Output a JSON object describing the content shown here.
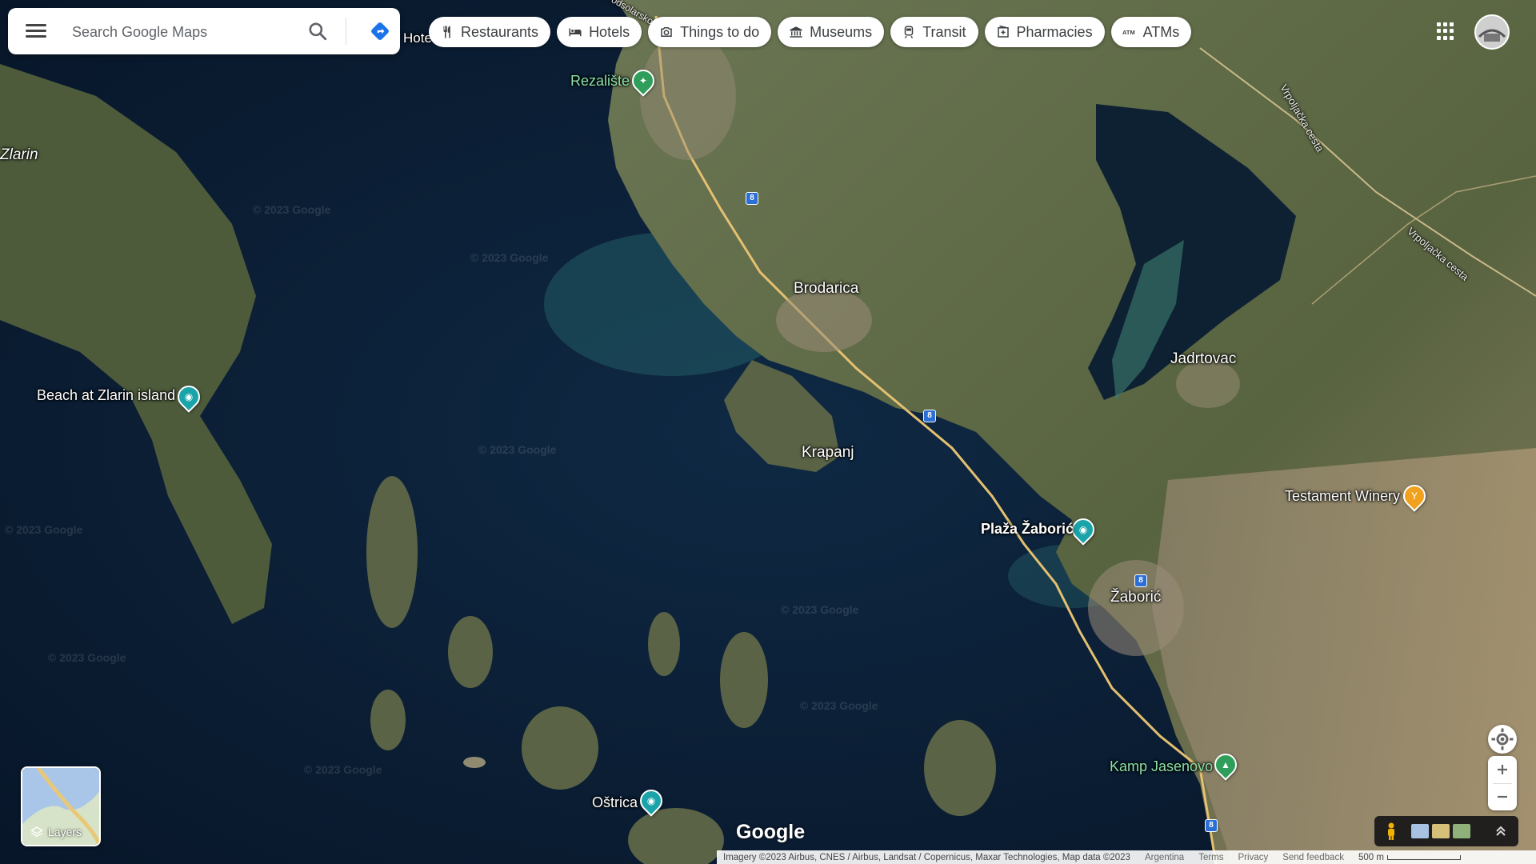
{
  "search": {
    "placeholder": "Search Google Maps"
  },
  "chips": [
    {
      "label": "Restaurants",
      "icon": "fork-knife-icon"
    },
    {
      "label": "Hotels",
      "icon": "bed-icon"
    },
    {
      "label": "Things to do",
      "icon": "camera-icon"
    },
    {
      "label": "Museums",
      "icon": "museum-icon"
    },
    {
      "label": "Transit",
      "icon": "train-icon"
    },
    {
      "label": "Pharmacies",
      "icon": "pharmacy-icon"
    },
    {
      "label": "ATMs",
      "icon": "atm-icon"
    }
  ],
  "places": {
    "zlarin": "Zlarin",
    "brodarica": "Brodarica",
    "krapanj": "Krapanj",
    "jadrtovac": "Jadrtovac",
    "zaboric": "Žaborić",
    "hotel_partial": "Hote",
    "road1": "Podsolarsko",
    "road2": "Vrpoljačka cesta",
    "road3": "Vrpoljačka cesta"
  },
  "pois": {
    "rezaliste": "Rezalište",
    "beach_zlarin": "Beach at Zlarin island",
    "plaza_zaboric": "Plaža Žaborić",
    "testament": "Testament Winery",
    "kamp": "Kamp Jasenovo",
    "ostrica": "Oštrica"
  },
  "road_number": "8",
  "layers": {
    "label": "Layers"
  },
  "logo": "Google",
  "watermark": "© 2023 Google",
  "footer": {
    "imagery": "Imagery ©2023 Airbus, CNES / Airbus, Landsat / Copernicus, Maxar Technologies, Map data ©2023",
    "country": "Argentina",
    "terms": "Terms",
    "privacy": "Privacy",
    "feedback": "Send feedback",
    "scale": "500 m"
  },
  "colors": {
    "water": "#0b1a30",
    "land": "#5f6d48",
    "poi_teal": "#1aa3a8",
    "poi_green": "#2f9e5a",
    "poi_orange": "#f0a21e",
    "accent_blue": "#1a73e8"
  }
}
